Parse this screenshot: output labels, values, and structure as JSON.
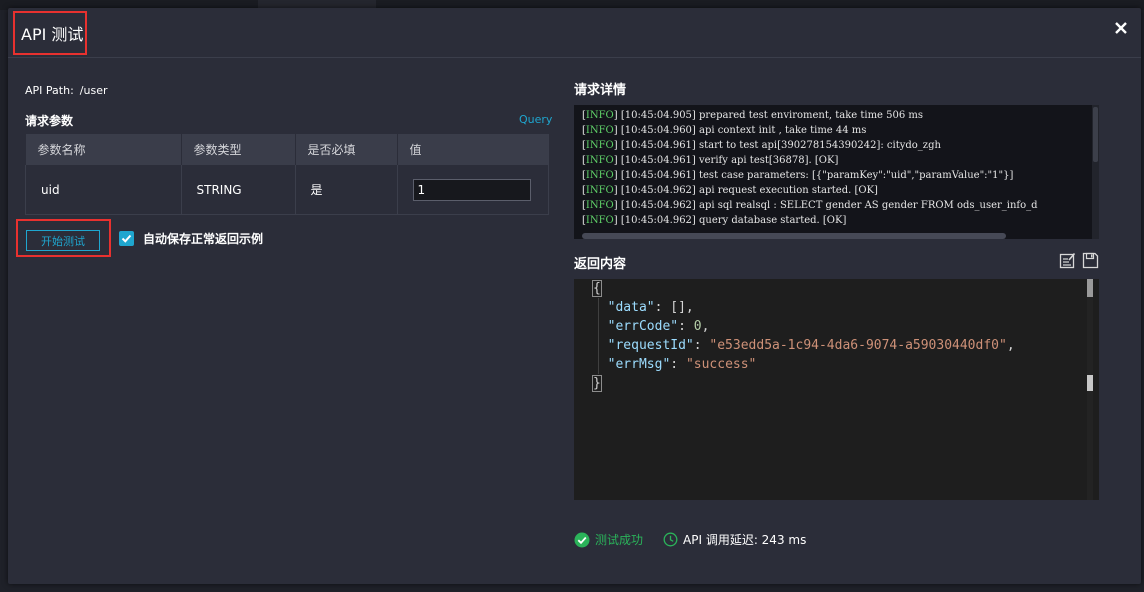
{
  "dialog": {
    "title": "API 测试"
  },
  "left": {
    "api_path_label": "API Path:",
    "api_path_value": "/user",
    "params_title": "请求参数",
    "query_link": "Query",
    "table": {
      "headers": [
        "参数名称",
        "参数类型",
        "是否必填",
        "值"
      ],
      "rows": [
        {
          "name": "uid",
          "type": "STRING",
          "required": "是",
          "value": "1"
        }
      ]
    },
    "start_button": "开始测试",
    "autosave_label": "自动保存正常返回示例",
    "autosave_checked": true
  },
  "right": {
    "request_details_title": "请求详情",
    "logs": [
      {
        "level": "INFO",
        "text": " [10:45:04.905] prepared test enviroment, take time 506 ms"
      },
      {
        "level": "INFO",
        "text": " [10:45:04.960] api context init , take time 44 ms"
      },
      {
        "level": "INFO",
        "text": " [10:45:04.961] start to test api[390278154390242]: citydo_zgh"
      },
      {
        "level": "INFO",
        "text": " [10:45:04.961] verify api test[36878]. [OK]"
      },
      {
        "level": "INFO",
        "text": " [10:45:04.961] test case parameters: [{\"paramKey\":\"uid\",\"paramValue\":\"1\"}]"
      },
      {
        "level": "INFO",
        "text": " [10:45:04.962] api request execution started. [OK]"
      },
      {
        "level": "INFO",
        "text": " [10:45:04.962] api sql realsql : SELECT gender AS gender FROM ods_user_info_d"
      },
      {
        "level": "INFO",
        "text": " [10:45:04.962] query database started. [OK]"
      }
    ],
    "response_title": "返回内容",
    "response_json": {
      "open": "{",
      "close": "}",
      "data_key": "\"data\"",
      "data_val": "[],",
      "errcode_key": "\"errCode\"",
      "errcode_val": "0",
      "requestid_key": "\"requestId\"",
      "requestid_val": "\"e53edd5a-1c94-4da6-9074-a59030440df0\"",
      "errmsg_key": "\"errMsg\"",
      "errmsg_val": "\"success\""
    },
    "status_success": "测试成功",
    "status_latency": "API 调用延迟: 243 ms"
  },
  "colors": {
    "accent": "#1fa6cf",
    "highlight_border": "#e8312f",
    "success": "#2bb35a",
    "log_level": "#5fd068"
  },
  "icons": [
    "close-icon",
    "checkmark-icon",
    "edit-icon",
    "save-icon",
    "success-check-icon",
    "clock-icon"
  ]
}
